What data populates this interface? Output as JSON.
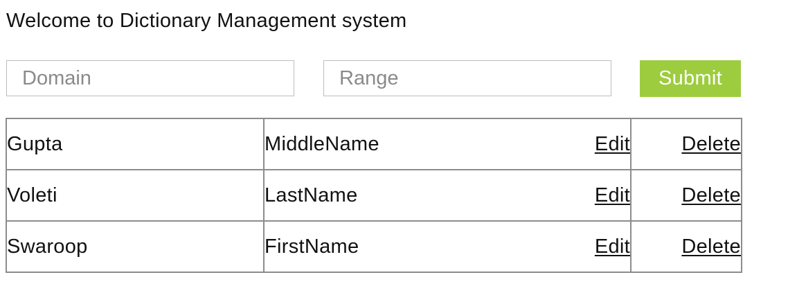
{
  "page": {
    "heading": "Welcome to Dictionary Management system"
  },
  "form": {
    "domain_placeholder": "Domain",
    "range_placeholder": "Range",
    "submit_label": "Submit",
    "submit_color": "#9dcc3f"
  },
  "table": {
    "rows": [
      {
        "domain": "Gupta",
        "range": "MiddleName",
        "edit_label": "Edit",
        "delete_label": "Delete"
      },
      {
        "domain": "Voleti",
        "range": "LastName",
        "edit_label": "Edit",
        "delete_label": "Delete"
      },
      {
        "domain": "Swaroop",
        "range": "FirstName",
        "edit_label": "Edit",
        "delete_label": "Delete"
      }
    ]
  }
}
